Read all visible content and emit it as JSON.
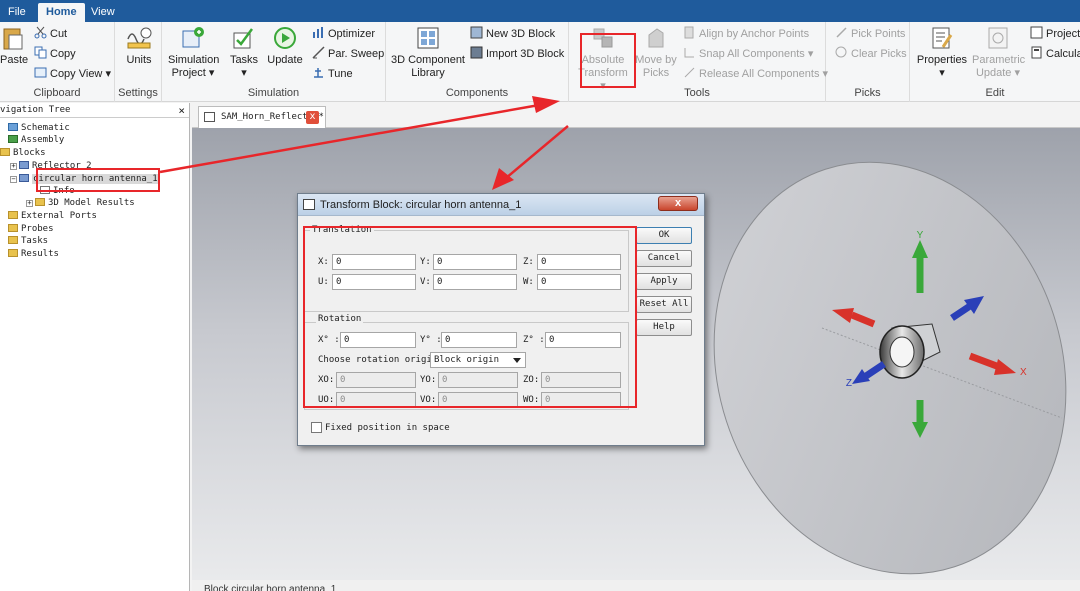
{
  "tabs": [
    "File",
    "Home",
    "View"
  ],
  "ribbon": {
    "clipboard": {
      "label": "Clipboard",
      "paste": "Paste",
      "cut": "Cut",
      "copy": "Copy",
      "copy_view": "Copy View"
    },
    "settings": {
      "label": "Settings",
      "units": "Units"
    },
    "simulation": {
      "label": "Simulation",
      "sim_project": "Simulation Project",
      "tasks": "Tasks",
      "update": "Update",
      "optimizer": "Optimizer",
      "par_sweep": "Par. Sweep",
      "tune": "Tune"
    },
    "components": {
      "label": "Components",
      "library": "3D Component Library",
      "new_block": "New 3D Block",
      "import_block": "Import 3D Block"
    },
    "tools": {
      "label": "Tools",
      "abs_transform": "Absolute Transform",
      "move_picks": "Move by Picks",
      "align_anchor": "Align by Anchor Points",
      "snap_all": "Snap All Components",
      "release_all": "Release All Components"
    },
    "picks": {
      "label": "Picks",
      "pick_points": "Pick Points",
      "clear_picks": "Clear Picks"
    },
    "edit": {
      "label": "Edit",
      "properties": "Properties",
      "param_update": "Parametric Update",
      "project": "Project",
      "calculate": "Calculat"
    }
  },
  "navtree": {
    "title": "vigation Tree",
    "close": "×",
    "items": [
      "Schematic",
      "Assembly",
      "Blocks",
      "Reflector_2",
      "circular horn antenna_1",
      "Info",
      "3D Model Results",
      "External Ports",
      "Probes",
      "Tasks",
      "Results"
    ]
  },
  "doc_tab": {
    "label": "SAM_Horn_Reflector*",
    "close": "x"
  },
  "status_text": "Block  circular horn antenna_1",
  "dialog": {
    "title": "Transform Block: circular horn antenna_1",
    "close": "x",
    "translation_label": "Translation",
    "rotation_label": "Rotation",
    "translation_fields": [
      {
        "label": "X:",
        "value": "0"
      },
      {
        "label": "Y:",
        "value": "0"
      },
      {
        "label": "Z:",
        "value": "0"
      },
      {
        "label": "U:",
        "value": "0"
      },
      {
        "label": "V:",
        "value": "0"
      },
      {
        "label": "W:",
        "value": "0"
      }
    ],
    "rotation_fields": [
      {
        "label": "X° :",
        "value": "0"
      },
      {
        "label": "Y° :",
        "value": "0"
      },
      {
        "label": "Z° :",
        "value": "0"
      }
    ],
    "origin_label": "Choose rotation origin:",
    "origin_value": "Block origin",
    "origin_fields": [
      {
        "label": "XO:",
        "value": "0"
      },
      {
        "label": "YO:",
        "value": "0"
      },
      {
        "label": "ZO:",
        "value": "0"
      },
      {
        "label": "UO:",
        "value": "0"
      },
      {
        "label": "VO:",
        "value": "0"
      },
      {
        "label": "WO:",
        "value": "0"
      }
    ],
    "buttons": [
      "OK",
      "Cancel",
      "Apply",
      "Reset All",
      "Help"
    ],
    "fixed_label": "Fixed position in space"
  },
  "axes": {
    "x": "X",
    "y": "Y",
    "z": "Z"
  },
  "colors": {
    "ribbon_blue": "#1f5b9c",
    "annotation_red": "#e8262a",
    "axis_red": "#d8322a",
    "axis_green": "#3aa83a",
    "axis_blue": "#2a3fb8"
  }
}
